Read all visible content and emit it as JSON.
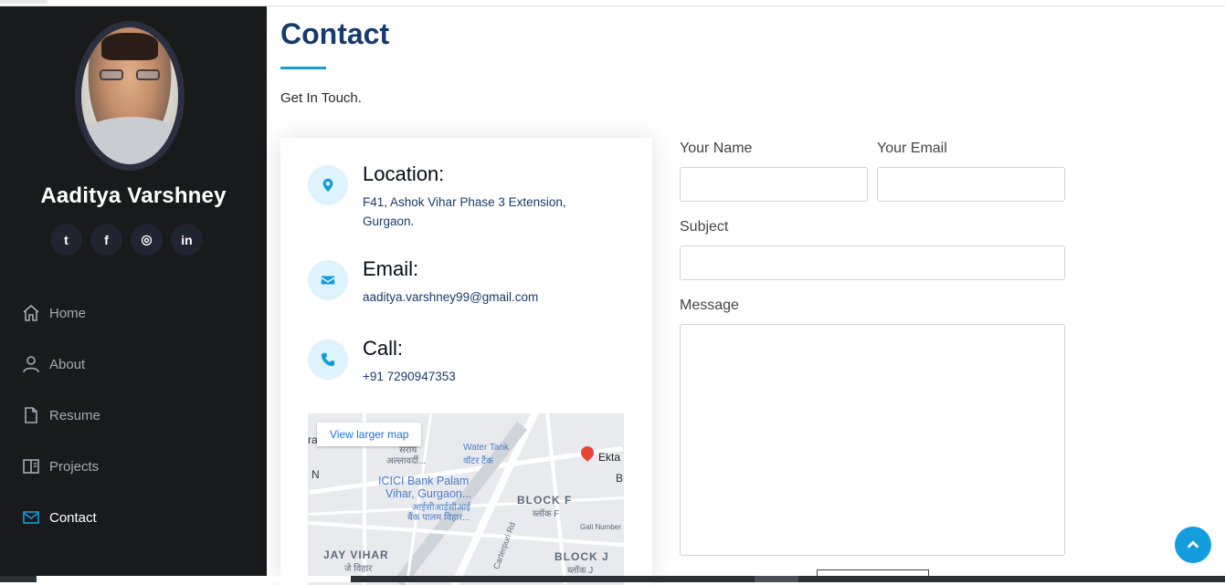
{
  "profile": {
    "name": "Aaditya Varshney"
  },
  "socials": [
    {
      "icon": "twitter-icon",
      "glyph": "t"
    },
    {
      "icon": "facebook-icon",
      "glyph": "f"
    },
    {
      "icon": "instagram-icon",
      "glyph": "◎"
    },
    {
      "icon": "linkedin-icon",
      "glyph": "in"
    }
  ],
  "nav": {
    "home": "Home",
    "about": "About",
    "resume": "Resume",
    "projects": "Projects",
    "contact": "Contact",
    "active": "contact"
  },
  "section": {
    "title": "Contact",
    "subtitle": "Get In Touch."
  },
  "info": {
    "location_title": "Location:",
    "location_text": "F41, Ashok Vihar Phase 3 Extension, Gurgaon.",
    "email_title": "Email:",
    "email_text": "aaditya.varshney99@gmail.com",
    "call_title": "Call:",
    "call_text": "+91 7290947353"
  },
  "map": {
    "view_larger": "View larger map",
    "labels": {
      "sarai": "सराय",
      "allawardi": "अल्लावर्दी...",
      "water_tank": "Water Tank",
      "water_tank_hi": "वॉटर टैंक",
      "ekta": "Ekta",
      "icici1": "ICICI Bank Palam",
      "icici2": "Vihar, Gurgaon...",
      "icici_hi1": "आईसीआईसीआई",
      "icici_hi2": "बैंक पालम विहार...",
      "block_f": "BLOCK F",
      "block_f_hi": "ब्लॉक F",
      "gali": "Gali Number",
      "carterpuri": "Carterpuri Rd",
      "jay_vihar": "JAY VIHAR",
      "jay_vihar_hi": "जे विहार",
      "block_j": "BLOCK J",
      "block_j_hi": "ब्लॉक J",
      "n": "N",
      "ra": "ra",
      "b": "B"
    }
  },
  "form": {
    "name_label": "Your Name",
    "email_label": "Your Email",
    "subject_label": "Subject",
    "message_label": "Message"
  },
  "colors": {
    "accent": "#149ddd",
    "title": "#173b6c",
    "sidebar": "#191a1b"
  }
}
